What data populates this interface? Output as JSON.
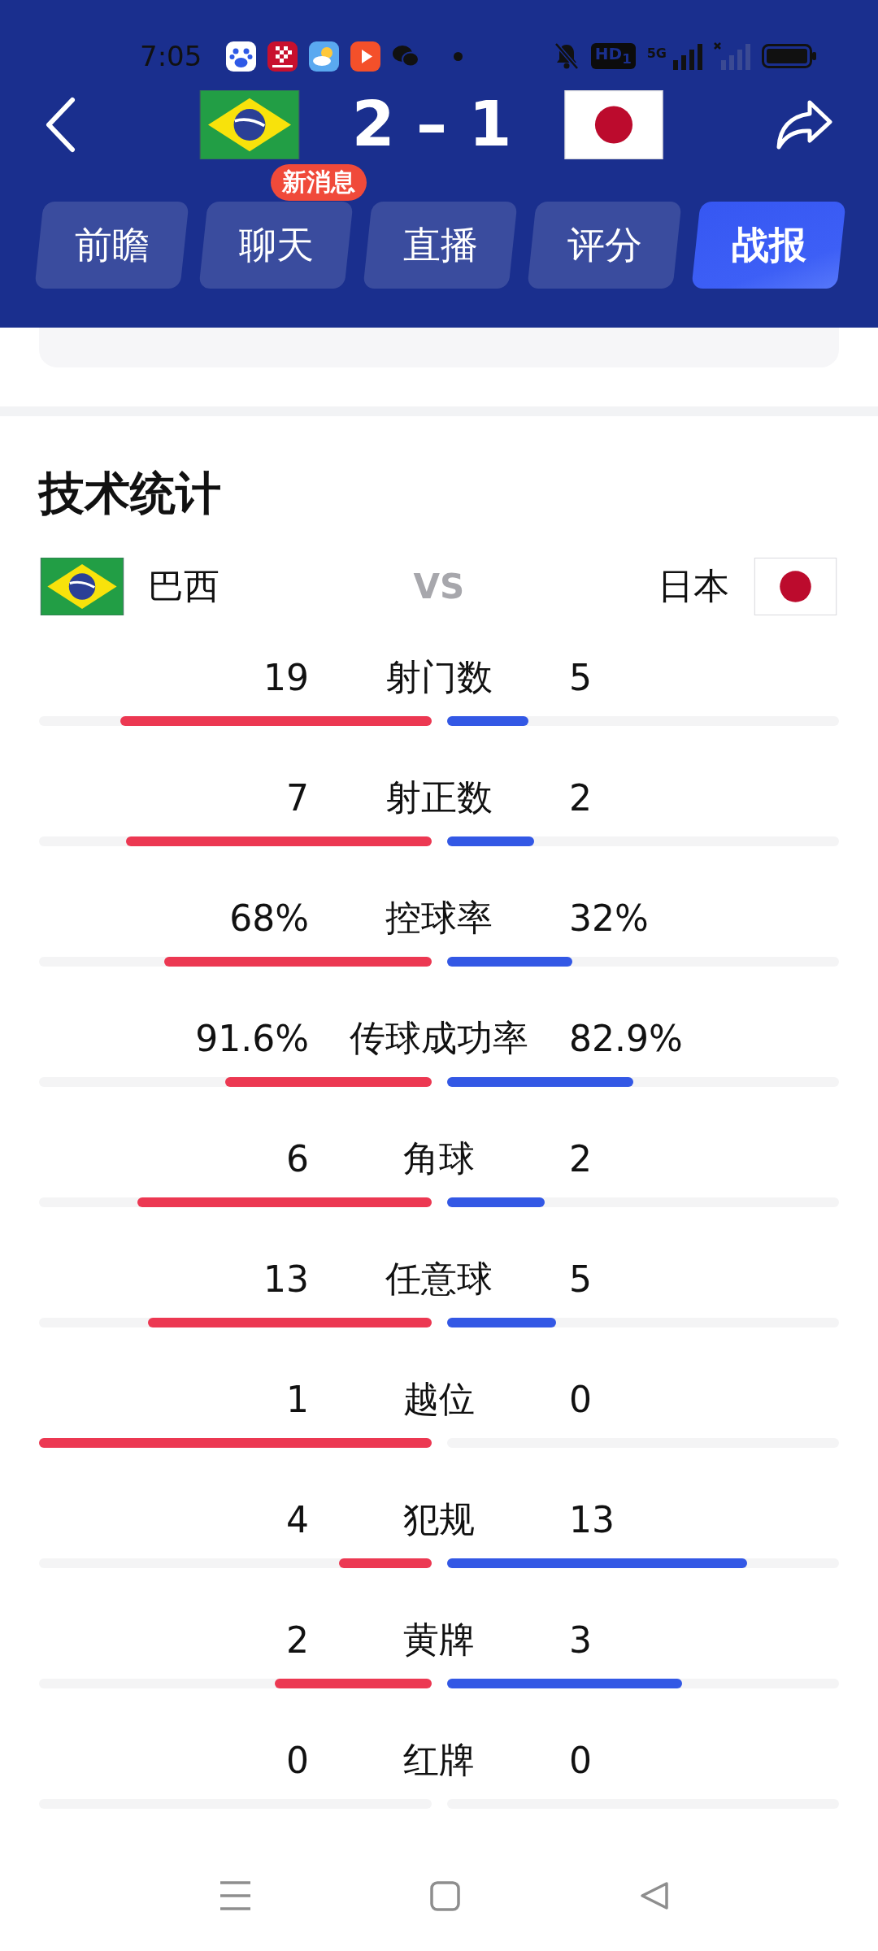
{
  "status_bar": {
    "time": "7:05",
    "hd_label": "HD$_{1}$",
    "network": "5G"
  },
  "match": {
    "score": "2 – 1"
  },
  "tabs": [
    {
      "label": "前瞻",
      "selected": false
    },
    {
      "label": "聊天",
      "selected": false,
      "badge": "新消息"
    },
    {
      "label": "直播",
      "selected": false
    },
    {
      "label": "评分",
      "selected": false
    },
    {
      "label": "战报",
      "selected": true
    }
  ],
  "stats": {
    "title": "技术统计",
    "home_team": "巴西",
    "vs": "VS",
    "away_team": "日本",
    "rows": [
      {
        "label": "射门数",
        "home": {
          "value": "19",
          "level": 0.792
        },
        "away": {
          "value": "5",
          "level": 0.208
        }
      },
      {
        "label": "射正数",
        "home": {
          "value": "7",
          "level": 0.778
        },
        "away": {
          "value": "2",
          "level": 0.222
        }
      },
      {
        "label": "控球率",
        "home": {
          "value": "68%",
          "level": 0.68
        },
        "away": {
          "value": "32%",
          "level": 0.32
        }
      },
      {
        "label": "传球成功率",
        "home": {
          "value": "91.6%",
          "level": 0.525
        },
        "away": {
          "value": "82.9%",
          "level": 0.475
        }
      },
      {
        "label": "角球",
        "home": {
          "value": "6",
          "level": 0.75
        },
        "away": {
          "value": "2",
          "level": 0.25
        }
      },
      {
        "label": "任意球",
        "home": {
          "value": "13",
          "level": 0.722
        },
        "away": {
          "value": "5",
          "level": 0.278
        }
      },
      {
        "label": "越位",
        "home": {
          "value": "1",
          "level": 1
        },
        "away": {
          "value": "0"
        }
      },
      {
        "label": "犯规",
        "home": {
          "value": "4",
          "level": 0.235
        },
        "away": {
          "value": "13",
          "level": 0.765
        }
      },
      {
        "label": "黄牌",
        "home": {
          "value": "2",
          "level": 0.4
        },
        "away": {
          "value": "3",
          "level": 0.6
        }
      },
      {
        "label": "红牌",
        "home": {
          "value": "0"
        },
        "away": {
          "value": "0"
        }
      }
    ]
  }
}
